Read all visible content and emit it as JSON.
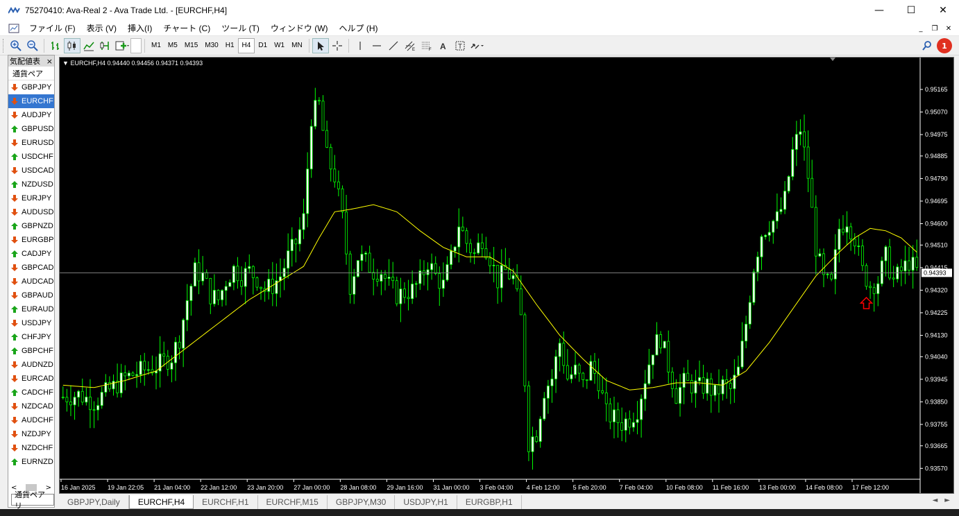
{
  "window": {
    "title": "75270410: Ava-Real 2 - Ava Trade Ltd. - [EURCHF,H4]",
    "min": "—",
    "max": "☐",
    "close": "✕"
  },
  "menu": [
    "ファイル (F)",
    "表示 (V)",
    "挿入(I)",
    "チャート (C)",
    "ツール (T)",
    "ウィンドウ (W)",
    "ヘルプ (H)"
  ],
  "timeframes": [
    "M1",
    "M5",
    "M15",
    "M30",
    "H1",
    "H4",
    "D1",
    "W1",
    "MN"
  ],
  "active_timeframe": "H4",
  "notification_count": "1",
  "market_watch": {
    "title": "気配値表",
    "column": "通貨ペア",
    "tab": "通貨ペアリ",
    "nav_left": "<",
    "nav_right": ">",
    "close": "×",
    "symbols": [
      {
        "name": "GBPJPY",
        "dir": "down"
      },
      {
        "name": "EURCHF",
        "dir": "down",
        "selected": true
      },
      {
        "name": "AUDJPY",
        "dir": "down"
      },
      {
        "name": "GBPUSD",
        "dir": "up"
      },
      {
        "name": "EURUSD",
        "dir": "down"
      },
      {
        "name": "USDCHF",
        "dir": "up"
      },
      {
        "name": "USDCAD",
        "dir": "down"
      },
      {
        "name": "NZDUSD",
        "dir": "up"
      },
      {
        "name": "EURJPY",
        "dir": "down"
      },
      {
        "name": "AUDUSD",
        "dir": "down"
      },
      {
        "name": "GBPNZD",
        "dir": "up"
      },
      {
        "name": "EURGBP",
        "dir": "down"
      },
      {
        "name": "CADJPY",
        "dir": "up"
      },
      {
        "name": "GBPCAD",
        "dir": "down"
      },
      {
        "name": "AUDCAD",
        "dir": "down"
      },
      {
        "name": "GBPAUD",
        "dir": "down"
      },
      {
        "name": "EURAUD",
        "dir": "up"
      },
      {
        "name": "USDJPY",
        "dir": "down"
      },
      {
        "name": "CHFJPY",
        "dir": "up"
      },
      {
        "name": "GBPCHF",
        "dir": "up"
      },
      {
        "name": "AUDNZD",
        "dir": "down"
      },
      {
        "name": "EURCAD",
        "dir": "down"
      },
      {
        "name": "CADCHF",
        "dir": "up"
      },
      {
        "name": "NZDCAD",
        "dir": "down"
      },
      {
        "name": "AUDCHF",
        "dir": "down"
      },
      {
        "name": "NZDJPY",
        "dir": "down"
      },
      {
        "name": "NZDCHF",
        "dir": "down"
      },
      {
        "name": "EURNZD",
        "dir": "up"
      }
    ]
  },
  "chart": {
    "info": "EURCHF,H4  0.94440 0.94456 0.94371 0.94393",
    "current_price": "0.94393",
    "colors": {
      "bull": "#ffffff",
      "bear": "#000000",
      "wick": "#00ff00",
      "ma": "#ffff00",
      "price_line": "#808080",
      "arrow": "#ff0000"
    }
  },
  "chart_data": {
    "type": "candlestick",
    "symbol": "EURCHF",
    "timeframe": "H4",
    "ylim": [
      0.9353,
      0.9527
    ],
    "y_ticks": [
      "0.95165",
      "0.95070",
      "0.94975",
      "0.94885",
      "0.94790",
      "0.94695",
      "0.94600",
      "0.94510",
      "0.94415",
      "0.94320",
      "0.94225",
      "0.94130",
      "0.94040",
      "0.93945",
      "0.93850",
      "0.93755",
      "0.93665",
      "0.93570"
    ],
    "x_ticks": [
      "16 Jan 2025",
      "19 Jan 22:05",
      "21 Jan 04:00",
      "22 Jan 12:00",
      "23 Jan 20:00",
      "27 Jan 00:00",
      "28 Jan 08:00",
      "29 Jan 16:00",
      "31 Jan 00:00",
      "3 Feb 04:00",
      "4 Feb 12:00",
      "5 Feb 20:00",
      "7 Feb 04:00",
      "10 Feb 08:00",
      "11 Feb 16:00",
      "13 Feb 00:00",
      "14 Feb 08:00",
      "17 Feb 12:00"
    ],
    "close_path": [
      [
        0,
        0.9387
      ],
      [
        4,
        0.9388
      ],
      [
        8,
        0.9385
      ],
      [
        12,
        0.939
      ],
      [
        16,
        0.9395
      ],
      [
        20,
        0.9398
      ],
      [
        24,
        0.94
      ],
      [
        28,
        0.9404
      ],
      [
        30,
        0.9412
      ],
      [
        32,
        0.9428
      ],
      [
        34,
        0.944
      ],
      [
        36,
        0.9438
      ],
      [
        38,
        0.943
      ],
      [
        40,
        0.9428
      ],
      [
        42,
        0.9436
      ],
      [
        44,
        0.9441
      ],
      [
        46,
        0.9438
      ],
      [
        48,
        0.944
      ],
      [
        50,
        0.9437
      ],
      [
        52,
        0.9432
      ],
      [
        54,
        0.9434
      ],
      [
        56,
        0.9438
      ],
      [
        58,
        0.9446
      ],
      [
        60,
        0.9452
      ],
      [
        62,
        0.9462
      ],
      [
        64,
        0.9505
      ],
      [
        66,
        0.951
      ],
      [
        68,
        0.9488
      ],
      [
        70,
        0.948
      ],
      [
        72,
        0.9462
      ],
      [
        74,
        0.9434
      ],
      [
        76,
        0.9446
      ],
      [
        78,
        0.9444
      ],
      [
        80,
        0.944
      ],
      [
        82,
        0.944
      ],
      [
        84,
        0.9434
      ],
      [
        86,
        0.943
      ],
      [
        88,
        0.9431
      ],
      [
        90,
        0.9432
      ],
      [
        92,
        0.9436
      ],
      [
        94,
        0.9444
      ],
      [
        96,
        0.9438
      ],
      [
        98,
        0.9434
      ],
      [
        100,
        0.9445
      ],
      [
        102,
        0.946
      ],
      [
        104,
        0.9452
      ],
      [
        106,
        0.9447
      ],
      [
        108,
        0.9454
      ],
      [
        110,
        0.9446
      ],
      [
        112,
        0.9436
      ],
      [
        114,
        0.944
      ],
      [
        116,
        0.9437
      ],
      [
        118,
        0.942
      ],
      [
        120,
        0.9368
      ],
      [
        122,
        0.9372
      ],
      [
        124,
        0.939
      ],
      [
        126,
        0.9395
      ],
      [
        128,
        0.941
      ],
      [
        130,
        0.9395
      ],
      [
        132,
        0.9398
      ],
      [
        134,
        0.9392
      ],
      [
        136,
        0.94
      ],
      [
        138,
        0.9394
      ],
      [
        140,
        0.938
      ],
      [
        142,
        0.9378
      ],
      [
        144,
        0.9376
      ],
      [
        146,
        0.9378
      ],
      [
        148,
        0.9382
      ],
      [
        150,
        0.9395
      ],
      [
        152,
        0.9408
      ],
      [
        154,
        0.9412
      ],
      [
        156,
        0.94
      ],
      [
        158,
        0.9388
      ],
      [
        160,
        0.9393
      ],
      [
        162,
        0.9392
      ],
      [
        164,
        0.9391
      ],
      [
        166,
        0.9392
      ],
      [
        168,
        0.9388
      ],
      [
        170,
        0.9392
      ],
      [
        172,
        0.939
      ],
      [
        174,
        0.9398
      ],
      [
        176,
        0.9418
      ],
      [
        178,
        0.9442
      ],
      [
        180,
        0.9456
      ],
      [
        182,
        0.946
      ],
      [
        184,
        0.9462
      ],
      [
        186,
        0.947
      ],
      [
        188,
        0.949
      ],
      [
        190,
        0.95
      ],
      [
        192,
        0.948
      ],
      [
        194,
        0.945
      ],
      [
        196,
        0.9436
      ],
      [
        198,
        0.9434
      ],
      [
        200,
        0.9458
      ],
      [
        202,
        0.9462
      ],
      [
        204,
        0.9454
      ],
      [
        206,
        0.944
      ],
      [
        208,
        0.9434
      ],
      [
        210,
        0.9436
      ],
      [
        212,
        0.9446
      ],
      [
        214,
        0.9436
      ],
      [
        216,
        0.944
      ],
      [
        218,
        0.9444
      ],
      [
        220,
        0.944
      ]
    ],
    "ma_path": [
      [
        0,
        0.9392
      ],
      [
        8,
        0.9391
      ],
      [
        16,
        0.9394
      ],
      [
        24,
        0.9398
      ],
      [
        32,
        0.9408
      ],
      [
        40,
        0.9418
      ],
      [
        48,
        0.9428
      ],
      [
        56,
        0.9436
      ],
      [
        62,
        0.9442
      ],
      [
        66,
        0.9454
      ],
      [
        70,
        0.9465
      ],
      [
        74,
        0.9466
      ],
      [
        80,
        0.9468
      ],
      [
        86,
        0.9465
      ],
      [
        92,
        0.9457
      ],
      [
        98,
        0.945
      ],
      [
        104,
        0.9446
      ],
      [
        110,
        0.9446
      ],
      [
        116,
        0.944
      ],
      [
        122,
        0.9426
      ],
      [
        128,
        0.9413
      ],
      [
        134,
        0.9403
      ],
      [
        140,
        0.9394
      ],
      [
        146,
        0.939
      ],
      [
        152,
        0.9391
      ],
      [
        158,
        0.9393
      ],
      [
        164,
        0.9393
      ],
      [
        170,
        0.9392
      ],
      [
        176,
        0.9398
      ],
      [
        182,
        0.941
      ],
      [
        188,
        0.9424
      ],
      [
        194,
        0.9438
      ],
      [
        200,
        0.9448
      ],
      [
        204,
        0.9454
      ],
      [
        208,
        0.9458
      ],
      [
        212,
        0.9457
      ],
      [
        216,
        0.9454
      ],
      [
        220,
        0.9448
      ]
    ],
    "n_bars": 221,
    "signal_arrow": {
      "bar": 207,
      "price": 0.9433,
      "direction": "up"
    }
  },
  "tabs": [
    "GBPJPY,Daily",
    "EURCHF,H4",
    "EURCHF,H1",
    "EURCHF,M15",
    "GBPJPY,M30",
    "USDJPY,H1",
    "EURGBP,H1"
  ],
  "active_tab": "EURCHF,H4",
  "tab_nav": {
    "left": "◄",
    "right": "►"
  }
}
